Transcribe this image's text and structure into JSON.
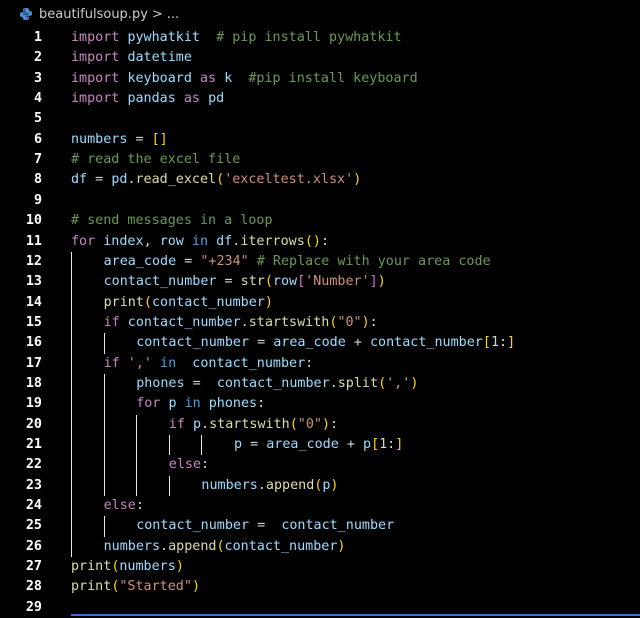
{
  "breadcrumb": {
    "file_icon": "python-file-icon",
    "file_name": "beautifulsoup.py",
    "separator": ">",
    "ellipsis": "..."
  },
  "editor": {
    "lines": [
      {
        "n": "1",
        "indent": 0,
        "tokens": [
          [
            "kw",
            "import"
          ],
          [
            "pl",
            " "
          ],
          [
            "id",
            "pywhatkit"
          ],
          [
            "pl",
            "  "
          ],
          [
            "cm",
            "# pip install pywhatkit"
          ]
        ]
      },
      {
        "n": "2",
        "indent": 0,
        "tokens": [
          [
            "kw",
            "import"
          ],
          [
            "pl",
            " "
          ],
          [
            "id",
            "datetime"
          ]
        ]
      },
      {
        "n": "3",
        "indent": 0,
        "tokens": [
          [
            "kw",
            "import"
          ],
          [
            "pl",
            " "
          ],
          [
            "id",
            "keyboard"
          ],
          [
            "pl",
            " "
          ],
          [
            "kw",
            "as"
          ],
          [
            "pl",
            " "
          ],
          [
            "id",
            "k"
          ],
          [
            "pl",
            "  "
          ],
          [
            "cm",
            "#pip install keyboard"
          ]
        ]
      },
      {
        "n": "4",
        "indent": 0,
        "tokens": [
          [
            "kw",
            "import"
          ],
          [
            "pl",
            " "
          ],
          [
            "id",
            "pandas"
          ],
          [
            "pl",
            " "
          ],
          [
            "kw",
            "as"
          ],
          [
            "pl",
            " "
          ],
          [
            "id",
            "pd"
          ]
        ]
      },
      {
        "n": "5",
        "indent": 0,
        "tokens": []
      },
      {
        "n": "6",
        "indent": 0,
        "tokens": [
          [
            "id",
            "numbers"
          ],
          [
            "pl",
            " = "
          ],
          [
            "br1",
            "[]"
          ]
        ]
      },
      {
        "n": "7",
        "indent": 0,
        "tokens": [
          [
            "cm",
            "# read the excel file"
          ]
        ]
      },
      {
        "n": "8",
        "indent": 0,
        "tokens": [
          [
            "id",
            "df"
          ],
          [
            "pl",
            " = "
          ],
          [
            "id",
            "pd"
          ],
          [
            "pl",
            "."
          ],
          [
            "fn",
            "read_excel"
          ],
          [
            "br1",
            "("
          ],
          [
            "str",
            "'exceltest.xlsx'"
          ],
          [
            "br1",
            ")"
          ]
        ]
      },
      {
        "n": "9",
        "indent": 0,
        "tokens": []
      },
      {
        "n": "10",
        "indent": 0,
        "tokens": [
          [
            "cm",
            "# send messages in a loop"
          ]
        ]
      },
      {
        "n": "11",
        "indent": 0,
        "tokens": [
          [
            "kw",
            "for"
          ],
          [
            "pl",
            " "
          ],
          [
            "id",
            "index"
          ],
          [
            "pl",
            ", "
          ],
          [
            "id",
            "row"
          ],
          [
            "pl",
            " "
          ],
          [
            "kwb",
            "in"
          ],
          [
            "pl",
            " "
          ],
          [
            "id",
            "df"
          ],
          [
            "pl",
            "."
          ],
          [
            "fn",
            "iterrows"
          ],
          [
            "br1",
            "()"
          ],
          [
            "pl",
            ":"
          ]
        ]
      },
      {
        "n": "12",
        "indent": 1,
        "tokens": [
          [
            "id",
            "area_code"
          ],
          [
            "pl",
            " = "
          ],
          [
            "str",
            "\"+234\""
          ],
          [
            "pl",
            " "
          ],
          [
            "cm",
            "# Replace with your area code"
          ]
        ]
      },
      {
        "n": "13",
        "indent": 1,
        "tokens": [
          [
            "id",
            "contact_number"
          ],
          [
            "pl",
            " = "
          ],
          [
            "fn",
            "str"
          ],
          [
            "br1",
            "("
          ],
          [
            "id",
            "row"
          ],
          [
            "br2",
            "["
          ],
          [
            "str",
            "'Number'"
          ],
          [
            "br2",
            "]"
          ],
          [
            "br1",
            ")"
          ]
        ]
      },
      {
        "n": "14",
        "indent": 1,
        "tokens": [
          [
            "fn",
            "print"
          ],
          [
            "br1",
            "("
          ],
          [
            "id",
            "contact_number"
          ],
          [
            "br1",
            ")"
          ]
        ]
      },
      {
        "n": "15",
        "indent": 1,
        "tokens": [
          [
            "kw",
            "if"
          ],
          [
            "pl",
            " "
          ],
          [
            "id",
            "contact_number"
          ],
          [
            "pl",
            "."
          ],
          [
            "fn",
            "startswith"
          ],
          [
            "br1",
            "("
          ],
          [
            "str",
            "\"0\""
          ],
          [
            "br1",
            ")"
          ],
          [
            "pl",
            ":"
          ]
        ]
      },
      {
        "n": "16",
        "indent": 2,
        "tokens": [
          [
            "id",
            "contact_number"
          ],
          [
            "pl",
            " = "
          ],
          [
            "id",
            "area_code"
          ],
          [
            "pl",
            " + "
          ],
          [
            "id",
            "contact_number"
          ],
          [
            "br1",
            "["
          ],
          [
            "pl",
            "1:"
          ],
          [
            "br1",
            "]"
          ]
        ]
      },
      {
        "n": "17",
        "indent": 1,
        "tokens": [
          [
            "kw",
            "if"
          ],
          [
            "pl",
            " "
          ],
          [
            "str",
            "','"
          ],
          [
            "pl",
            " "
          ],
          [
            "kwb",
            "in"
          ],
          [
            "pl",
            "  "
          ],
          [
            "id",
            "contact_number"
          ],
          [
            "pl",
            ":"
          ]
        ]
      },
      {
        "n": "18",
        "indent": 2,
        "tokens": [
          [
            "id",
            "phones"
          ],
          [
            "pl",
            " =  "
          ],
          [
            "id",
            "contact_number"
          ],
          [
            "pl",
            "."
          ],
          [
            "fn",
            "split"
          ],
          [
            "br1",
            "("
          ],
          [
            "str",
            "','"
          ],
          [
            "br1",
            ")"
          ]
        ]
      },
      {
        "n": "19",
        "indent": 2,
        "tokens": [
          [
            "kw",
            "for"
          ],
          [
            "pl",
            " "
          ],
          [
            "id",
            "p"
          ],
          [
            "pl",
            " "
          ],
          [
            "kwb",
            "in"
          ],
          [
            "pl",
            " "
          ],
          [
            "id",
            "phones"
          ],
          [
            "pl",
            ":"
          ]
        ]
      },
      {
        "n": "20",
        "indent": 3,
        "tokens": [
          [
            "kw",
            "if"
          ],
          [
            "pl",
            " "
          ],
          [
            "id",
            "p"
          ],
          [
            "pl",
            "."
          ],
          [
            "fn",
            "startswith"
          ],
          [
            "br1",
            "("
          ],
          [
            "str",
            "\"0\""
          ],
          [
            "br1",
            ")"
          ],
          [
            "pl",
            ":"
          ]
        ]
      },
      {
        "n": "21",
        "indent": 5,
        "tokens": [
          [
            "id",
            "p"
          ],
          [
            "pl",
            " = "
          ],
          [
            "id",
            "area_code"
          ],
          [
            "pl",
            " + "
          ],
          [
            "id",
            "p"
          ],
          [
            "br1",
            "["
          ],
          [
            "pl",
            "1:"
          ],
          [
            "br1",
            "]"
          ]
        ]
      },
      {
        "n": "22",
        "indent": 3,
        "tokens": [
          [
            "kw",
            "else"
          ],
          [
            "pl",
            ":"
          ]
        ]
      },
      {
        "n": "23",
        "indent": 4,
        "tokens": [
          [
            "id",
            "numbers"
          ],
          [
            "pl",
            "."
          ],
          [
            "fn",
            "append"
          ],
          [
            "br1",
            "("
          ],
          [
            "id",
            "p"
          ],
          [
            "br1",
            ")"
          ]
        ]
      },
      {
        "n": "24",
        "indent": 1,
        "tokens": [
          [
            "kw",
            "else"
          ],
          [
            "pl",
            ":"
          ]
        ]
      },
      {
        "n": "25",
        "indent": 2,
        "tokens": [
          [
            "id",
            "contact_number"
          ],
          [
            "pl",
            " =  "
          ],
          [
            "id",
            "contact_number"
          ]
        ]
      },
      {
        "n": "26",
        "indent": 1,
        "tokens": [
          [
            "id",
            "numbers"
          ],
          [
            "pl",
            "."
          ],
          [
            "fn",
            "append"
          ],
          [
            "br1",
            "("
          ],
          [
            "id",
            "contact_number"
          ],
          [
            "br1",
            ")"
          ]
        ]
      },
      {
        "n": "27",
        "indent": 0,
        "tokens": [
          [
            "fn",
            "print"
          ],
          [
            "br1",
            "("
          ],
          [
            "id",
            "numbers"
          ],
          [
            "br1",
            ")"
          ]
        ]
      },
      {
        "n": "28",
        "indent": 0,
        "tokens": [
          [
            "fn",
            "print"
          ],
          [
            "br1",
            "("
          ],
          [
            "str",
            "\"Started\""
          ],
          [
            "br1",
            ")"
          ]
        ]
      },
      {
        "n": "29",
        "indent": 0,
        "tokens": []
      }
    ]
  },
  "colors": {
    "background": "#000000",
    "keyword": "#c586c0",
    "identifier": "#9cdcfe",
    "function": "#dcdcaa",
    "string": "#ce9178",
    "comment": "#6a9955",
    "bracket": "#ffd700",
    "line_number": "#ffffff",
    "indent_guide": "#e6e6e6"
  }
}
